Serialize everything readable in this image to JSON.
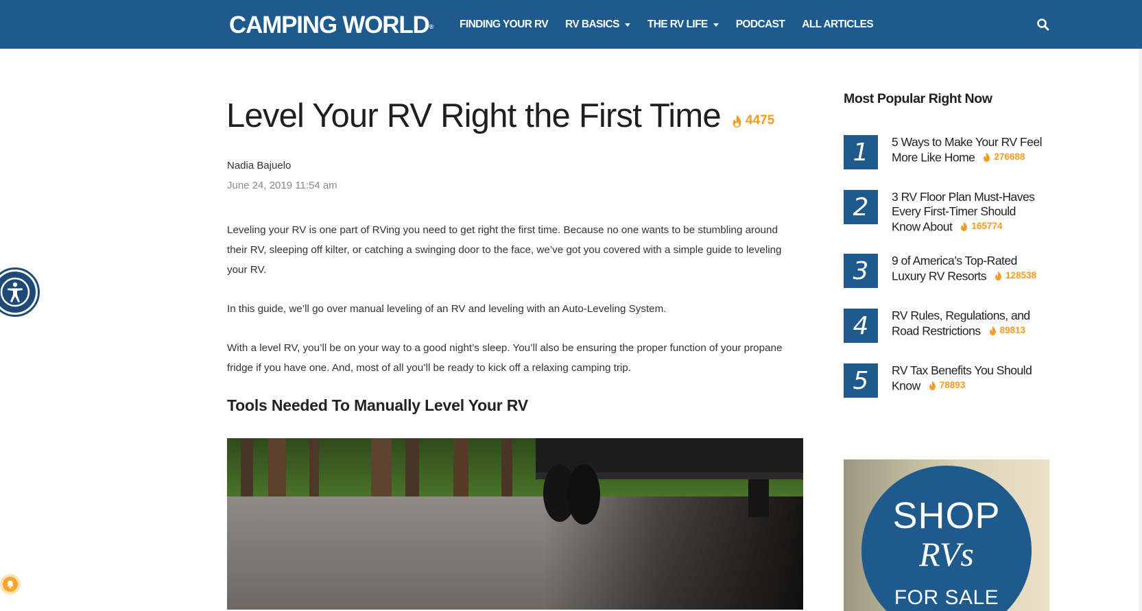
{
  "header": {
    "logo": "CAMPING WORLD",
    "logo_mark": "®",
    "nav": [
      {
        "label": "FINDING YOUR RV",
        "dropdown": false
      },
      {
        "label": "RV BASICS",
        "dropdown": true
      },
      {
        "label": "THE RV LIFE",
        "dropdown": true
      },
      {
        "label": "PODCAST",
        "dropdown": false
      },
      {
        "label": "ALL ARTICLES",
        "dropdown": false
      }
    ],
    "search_icon": "search-icon"
  },
  "article": {
    "title": "Level Your RV Right the First Time",
    "views": "4475",
    "author": "Nadia Bajuelo",
    "date": "June 24, 2019 11:54 am",
    "paragraphs": [
      "Leveling your RV is one part of RVing you need to get right the first time. Because no one wants to be stumbling around their RV, sleeping off kilter, or catching a swinging door to the face, we’ve got you covered with a simple guide to leveling your RV.",
      "In this guide, we’ll go over manual leveling of an RV and leveling with an Auto-Leveling System.",
      "With a level RV, you’ll be on your way to a good night’s sleep. You’ll also be ensuring the proper function of your propane fridge if you have one. And, most of all you’ll be ready to kick off a relaxing camping trip."
    ],
    "subheading": "Tools Needed To Manually Level Your RV"
  },
  "sidebar": {
    "title": "Most Popular Right Now",
    "items": [
      {
        "rank": "1",
        "title_lines": [
          "5 Ways to Make Your RV Feel",
          "More Like Home"
        ],
        "views": "276688"
      },
      {
        "rank": "2",
        "title_lines": [
          "3 RV Floor Plan Must-Haves",
          "Every First-Timer Should",
          "Know About"
        ],
        "views": "165774"
      },
      {
        "rank": "3",
        "title_lines": [
          "9 of America’s Top-Rated",
          "Luxury RV Resorts"
        ],
        "views": "128538"
      },
      {
        "rank": "4",
        "title_lines": [
          "RV Rules, Regulations, and",
          "Road Restrictions"
        ],
        "views": "89813"
      },
      {
        "rank": "5",
        "title_lines": [
          "RV Tax Benefits You Should",
          "Know"
        ],
        "views": "78893"
      }
    ],
    "ad": {
      "line1": "SHOP",
      "line2": "RVs",
      "line3": "FOR SALE"
    }
  },
  "colors": {
    "brand_blue": "#1f5a8d",
    "accent_orange": "#f39c21"
  }
}
